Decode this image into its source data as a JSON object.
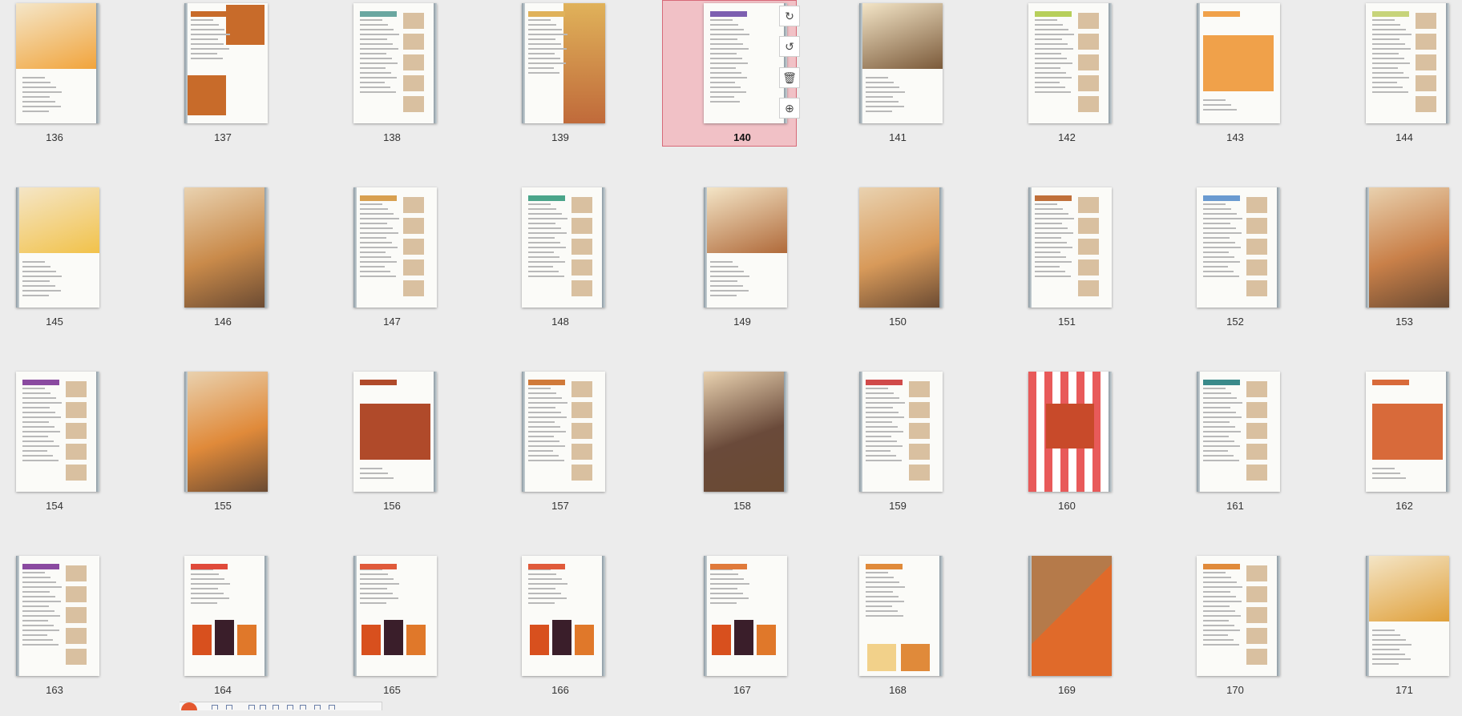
{
  "thumbnails": [
    {
      "page": "136",
      "style": "photo-top",
      "accent": "#f1a33a"
    },
    {
      "page": "137",
      "style": "split",
      "accent": "#c86b2a"
    },
    {
      "page": "138",
      "style": "steps",
      "accent": "#6aa7a0"
    },
    {
      "page": "139",
      "style": "photo-right",
      "accent": "#e0b25a"
    },
    {
      "page": "140",
      "style": "text",
      "accent": "#7d5fb0"
    },
    {
      "page": "141",
      "style": "photo-top",
      "accent": "#7b5a3a"
    },
    {
      "page": "142",
      "style": "steps",
      "accent": "#b7cf5a"
    },
    {
      "page": "143",
      "style": "photo-full-light",
      "accent": "#f0a14a"
    },
    {
      "page": "144",
      "style": "steps",
      "accent": "#c7d47a"
    },
    {
      "page": "145",
      "style": "photo-top",
      "accent": "#f2c24a"
    },
    {
      "page": "146",
      "style": "photo-full",
      "accent": "#c98a4a"
    },
    {
      "page": "147",
      "style": "steps",
      "accent": "#d8a050"
    },
    {
      "page": "148",
      "style": "steps",
      "accent": "#4aa58a"
    },
    {
      "page": "149",
      "style": "photo-top",
      "accent": "#b06a3a"
    },
    {
      "page": "150",
      "style": "photo-full",
      "accent": "#d89a5a"
    },
    {
      "page": "151",
      "style": "steps",
      "accent": "#c0703a"
    },
    {
      "page": "152",
      "style": "steps",
      "accent": "#6a9ad0"
    },
    {
      "page": "153",
      "style": "photo-full",
      "accent": "#c98049"
    },
    {
      "page": "154",
      "style": "steps",
      "accent": "#8a4aa0"
    },
    {
      "page": "155",
      "style": "photo-full",
      "accent": "#e08a3a"
    },
    {
      "page": "156",
      "style": "photo-full-light",
      "accent": "#b04a2a"
    },
    {
      "page": "157",
      "style": "steps",
      "accent": "#d07a3a"
    },
    {
      "page": "158",
      "style": "photo-full",
      "accent": "#6a4a3a"
    },
    {
      "page": "159",
      "style": "steps",
      "accent": "#d04a4a"
    },
    {
      "page": "160",
      "style": "photo-striped",
      "accent": "#e04a4a"
    },
    {
      "page": "161",
      "style": "steps",
      "accent": "#3a8a8a"
    },
    {
      "page": "162",
      "style": "photo-full-light",
      "accent": "#d86a3a"
    },
    {
      "page": "163",
      "style": "steps",
      "accent": "#8a4aa0"
    },
    {
      "page": "164",
      "style": "photo-jars",
      "accent": "#e04a3a"
    },
    {
      "page": "165",
      "style": "photo-jars",
      "accent": "#e05a3a"
    },
    {
      "page": "166",
      "style": "photo-jars",
      "accent": "#e05a3a"
    },
    {
      "page": "167",
      "style": "photo-jars",
      "accent": "#e07a3a"
    },
    {
      "page": "168",
      "style": "text-bottom-photo",
      "accent": "#e08a3a"
    },
    {
      "page": "169",
      "style": "photo-orange",
      "accent": "#e06a2a"
    },
    {
      "page": "170",
      "style": "steps",
      "accent": "#e08a3a"
    },
    {
      "page": "171",
      "style": "photo-top",
      "accent": "#e0a03a"
    }
  ],
  "selected_page": "140",
  "tools": {
    "rotate_cw_icon": "rotate-clockwise-icon",
    "rotate_ccw_icon": "rotate-counterclockwise-icon",
    "delete_icon": "trash-icon",
    "insert_icon": "add-page-icon"
  }
}
